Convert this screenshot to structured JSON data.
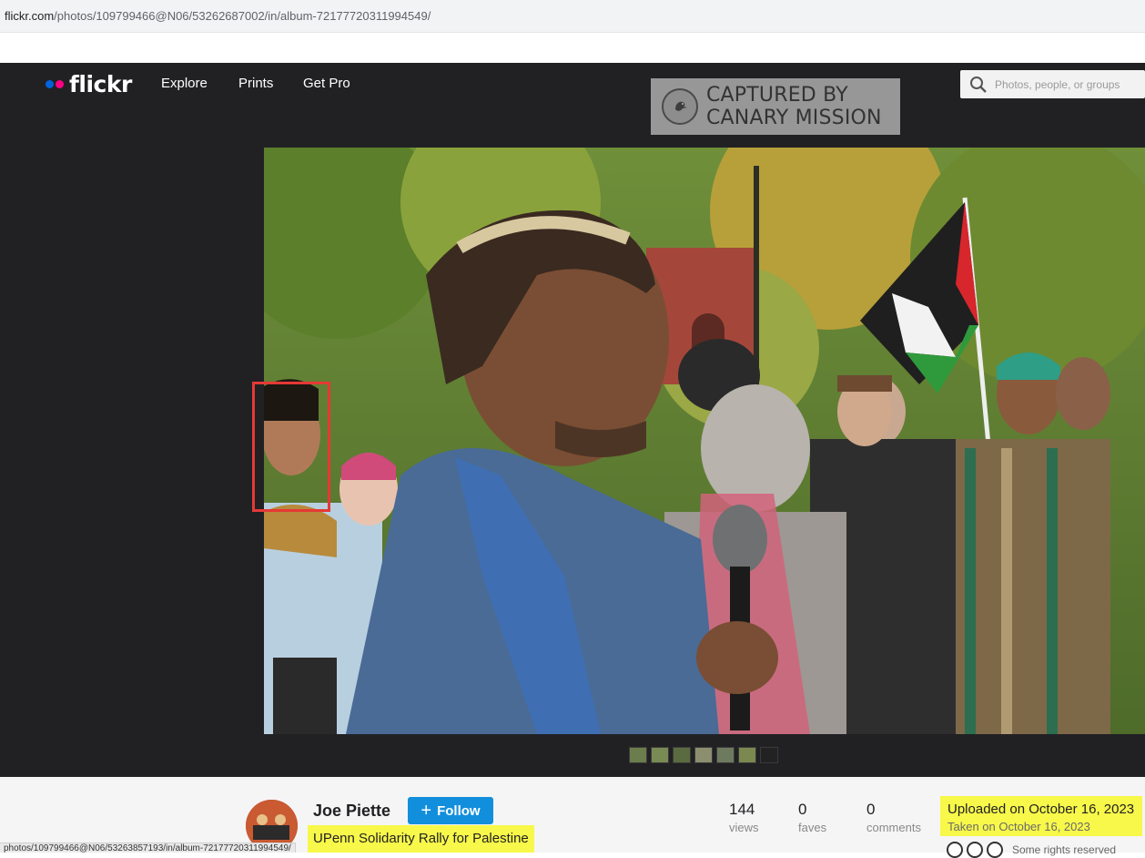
{
  "browser": {
    "url_host": "flickr.com",
    "url_path": "/photos/109799466@N06/53262687002/in/album-72177720311994549/",
    "status_url": "photos/109799466@N06/53263857193/in/album-72177720311994549/"
  },
  "nav": {
    "logo": "flickr",
    "links": [
      "Explore",
      "Prints",
      "Get Pro"
    ],
    "search_placeholder": "Photos, people, or groups"
  },
  "watermark": {
    "line1": "CAPTURED BY",
    "line2": "CANARY MISSION"
  },
  "photo": {
    "thumbnail_count": 7
  },
  "info": {
    "owner": "Joe Piette",
    "follow_label": "Follow",
    "title": "UPenn Solidarity Rally for Palestine",
    "stats": [
      {
        "value": "144",
        "label": "views"
      },
      {
        "value": "0",
        "label": "faves"
      },
      {
        "value": "0",
        "label": "comments"
      }
    ],
    "uploaded": "Uploaded on October 16, 2023",
    "taken": "Taken on October 16, 2023",
    "rights": "Some rights reserved"
  },
  "colors": {
    "flickr_blue": "#0063dc",
    "flickr_pink": "#ff0084",
    "follow_button": "#128fdc",
    "highlight_yellow": "#f8f84a",
    "annotation_red": "#e53935"
  }
}
